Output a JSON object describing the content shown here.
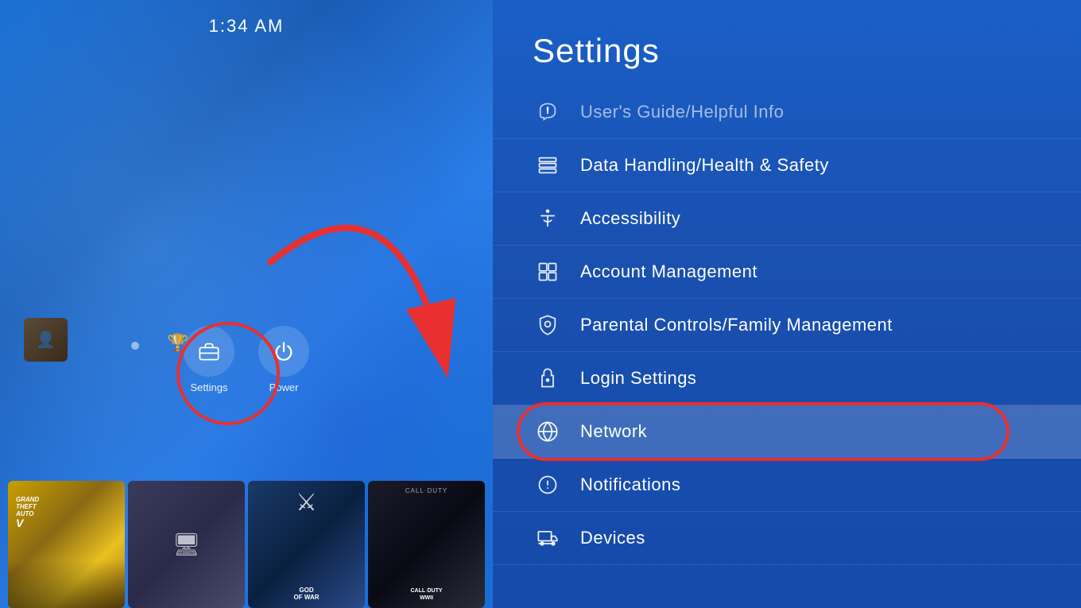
{
  "header": {
    "time": "1:34 AM"
  },
  "left": {
    "settings_label": "Settings",
    "power_label": "Power",
    "games": [
      {
        "id": "gta",
        "label": "GRAND THEFT AUTO V"
      },
      {
        "id": "monitor",
        "label": ""
      },
      {
        "id": "gow",
        "label": "GOD OF WAR"
      },
      {
        "id": "cod",
        "label": "CALL OF DUTY WWII"
      }
    ]
  },
  "settings": {
    "title": "Settings",
    "items": [
      {
        "id": "users-guide",
        "label": "User's Guide/Helpful Info",
        "icon": "📋",
        "dimmed": true
      },
      {
        "id": "data-handling",
        "label": "Data Handling/Health & Safety",
        "icon": "🗄️",
        "dimmed": false
      },
      {
        "id": "accessibility",
        "label": "Accessibility",
        "icon": "♿",
        "dimmed": false
      },
      {
        "id": "account-management",
        "label": "Account Management",
        "icon": "👤",
        "dimmed": false
      },
      {
        "id": "parental-controls",
        "label": "Parental Controls/Family Management",
        "icon": "🔒",
        "dimmed": false
      },
      {
        "id": "login-settings",
        "label": "Login Settings",
        "icon": "🔑",
        "dimmed": false
      },
      {
        "id": "network",
        "label": "Network",
        "icon": "🌐",
        "dimmed": false,
        "active": true
      },
      {
        "id": "notifications",
        "label": "Notifications",
        "icon": "🔔",
        "dimmed": false
      },
      {
        "id": "devices",
        "label": "Devices",
        "icon": "🖥️",
        "dimmed": false
      }
    ]
  }
}
